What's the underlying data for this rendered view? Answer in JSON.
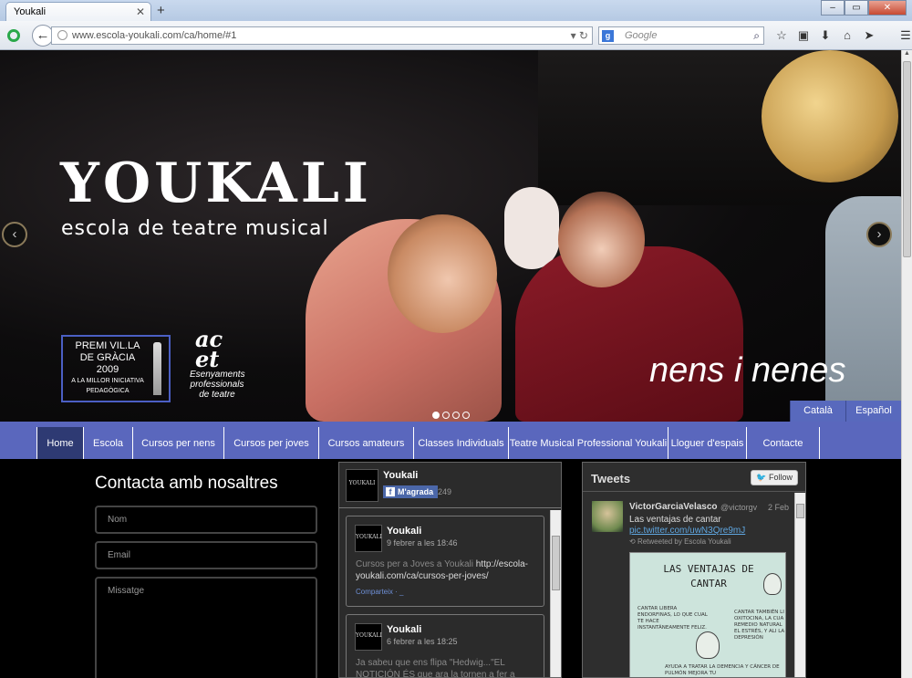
{
  "browser": {
    "tab_title": "Youkali",
    "tab_close": "✕",
    "new_tab": "+",
    "url": "www.escola-youkali.com/ca/home/#1",
    "search_placeholder": "Google",
    "search_engine_letter": "g",
    "window_controls": [
      "–",
      "▭",
      "✕"
    ],
    "toolbar_icons": [
      "star-icon",
      "clipboard-icon",
      "download-icon",
      "home-icon",
      "send-icon",
      "menu-icon"
    ]
  },
  "hero": {
    "logo": "YOUKALI",
    "tagline": "escola de teatre musical",
    "prize_line1": "PREMI VIL.LA",
    "prize_line2": "DE GRÀCIA 2009",
    "prize_line3": "A LA MILLOR INICIATIVA",
    "prize_line4": "PEDAGÒGICA",
    "acet_mark": "ac\net",
    "acet_sub": "Esenyaments professionals de teatre",
    "caption": "nens i nenes",
    "prev": "‹",
    "next": "›",
    "dots": 4,
    "active_dot": 0
  },
  "languages": [
    "Català",
    "Español"
  ],
  "nav": {
    "items": [
      {
        "label": "Home",
        "active": true
      },
      {
        "label": "Escola"
      },
      {
        "label": "Cursos per nens"
      },
      {
        "label": "Cursos per joves"
      },
      {
        "label": "Cursos amateurs"
      },
      {
        "label": "Classes Individuals"
      },
      {
        "label": "Teatre Musical Professional Youkali"
      },
      {
        "label": "Lloguer d'espais"
      },
      {
        "label": "Contacte"
      }
    ]
  },
  "contact": {
    "title": "Contacta amb nosaltres",
    "name_placeholder": "Nom",
    "email_placeholder": "Email",
    "message_placeholder": "Missatge"
  },
  "facebook": {
    "page_name": "Youkali",
    "like_label": "M'agrada",
    "like_count": "249",
    "thumb_text": "YOUKALI",
    "posts": [
      {
        "author": "Youkali",
        "date": "9 febrer a les 18:46",
        "text": "Cursos per a Joves a Youkali ",
        "link": "http://escola-youkali.com/ca/cursos-per-joves/",
        "share": "Comparteix · _"
      },
      {
        "author": "Youkali",
        "date": "6 febrer a les 18:25",
        "text": "Ja sabeu que ens flipa \"Hedwig...\"EL NOTICIÓN ÉS que ara la tornen a fer a"
      }
    ]
  },
  "twitter": {
    "title": "Tweets",
    "follow_label": "Follow",
    "tweet": {
      "name": "VictorGarciaVelasco",
      "handle": "@victorgv",
      "date": "2 Feb",
      "text": "Las ventajas de cantar",
      "link": "pic.twitter.com/uwN3Qre9mJ",
      "retweet": "Retweeted by Escola Youkali"
    },
    "media": {
      "title": "LAS VENTAJAS DE CANTAR",
      "left_text": "CANTAR LIBERA ENDORFINAS, LO QUE CUAL TE HACE INSTANTÁNEAMENTE FELIZ.",
      "right_text": "CANTAR TAMBIÉN LI OXITOCINA, LA CUA REMEDIO NATURAL EL ESTRÉS, Y ALI LA DEPRESIÓN",
      "bottom_text": "AYUDA A TRATAR LA DEMENCIA Y CÁNCER DE PULMÓN MEJORA TU"
    }
  }
}
